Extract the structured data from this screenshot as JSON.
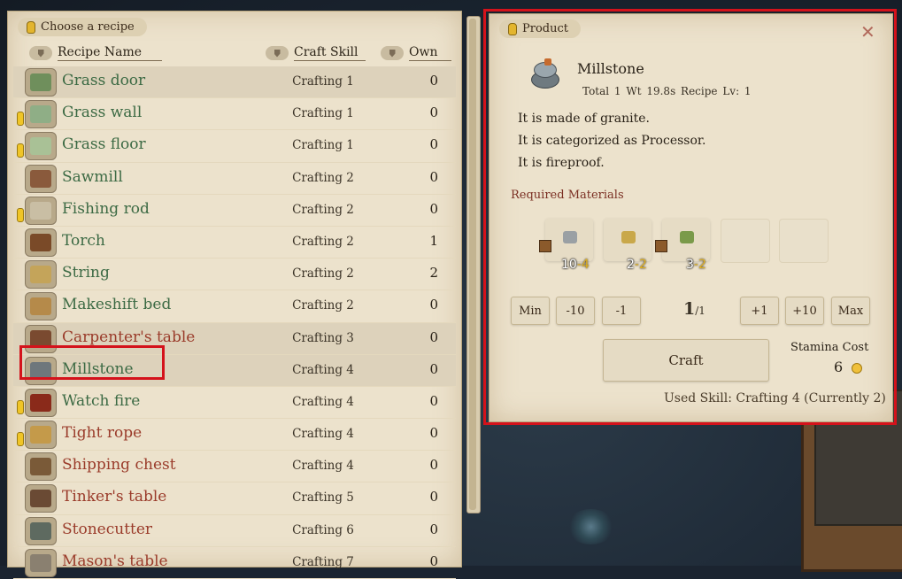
{
  "left": {
    "tab_title": "Choose a recipe",
    "columns": {
      "name": "Recipe Name",
      "skill": "Craft Skill",
      "own": "Own"
    },
    "recipes": [
      {
        "name": "Grass door",
        "skill": "Crafting 1",
        "own": "0",
        "color": "green",
        "warn": false,
        "icon": "grass-door-icon",
        "icon_color": "#6f8f5c"
      },
      {
        "name": "Grass wall",
        "skill": "Crafting 1",
        "own": "0",
        "color": "green",
        "warn": true,
        "icon": "grass-wall-icon",
        "icon_color": "#8fae86"
      },
      {
        "name": "Grass floor",
        "skill": "Crafting 1",
        "own": "0",
        "color": "green",
        "warn": true,
        "icon": "grass-floor-icon",
        "icon_color": "#a9c196"
      },
      {
        "name": "Sawmill",
        "skill": "Crafting 2",
        "own": "0",
        "color": "green",
        "warn": false,
        "icon": "sawmill-icon",
        "icon_color": "#8a5a3c"
      },
      {
        "name": "Fishing rod",
        "skill": "Crafting 2",
        "own": "0",
        "color": "green",
        "warn": true,
        "icon": "fishing-rod-icon",
        "icon_color": "#c9bea4"
      },
      {
        "name": "Torch",
        "skill": "Crafting 2",
        "own": "1",
        "color": "green",
        "warn": false,
        "icon": "torch-icon",
        "icon_color": "#7a4a28"
      },
      {
        "name": "String",
        "skill": "Crafting 2",
        "own": "2",
        "color": "green",
        "warn": false,
        "icon": "string-icon",
        "icon_color": "#c4a45a"
      },
      {
        "name": "Makeshift bed",
        "skill": "Crafting 2",
        "own": "0",
        "color": "green",
        "warn": false,
        "icon": "makeshift-bed-icon",
        "icon_color": "#b58a4a"
      },
      {
        "name": "Carpenter's table",
        "skill": "Crafting 3",
        "own": "0",
        "color": "red",
        "warn": false,
        "icon": "carpenters-table-icon",
        "icon_color": "#7a4a30"
      },
      {
        "name": "Millstone",
        "skill": "Crafting 4",
        "own": "0",
        "color": "green",
        "warn": false,
        "icon": "millstone-icon",
        "icon_color": "#6e777c"
      },
      {
        "name": "Watch fire",
        "skill": "Crafting 4",
        "own": "0",
        "color": "green",
        "warn": true,
        "icon": "watch-fire-icon",
        "icon_color": "#8a2a1a"
      },
      {
        "name": "Tight rope",
        "skill": "Crafting 4",
        "own": "0",
        "color": "red",
        "warn": true,
        "icon": "tight-rope-icon",
        "icon_color": "#c49a4a"
      },
      {
        "name": "Shipping chest",
        "skill": "Crafting 4",
        "own": "0",
        "color": "red",
        "warn": false,
        "icon": "shipping-chest-icon",
        "icon_color": "#7a5a38"
      },
      {
        "name": "Tinker's table",
        "skill": "Crafting 5",
        "own": "0",
        "color": "red",
        "warn": false,
        "icon": "tinkers-table-icon",
        "icon_color": "#6a4a34"
      },
      {
        "name": "Stonecutter",
        "skill": "Crafting 6",
        "own": "0",
        "color": "red",
        "warn": false,
        "icon": "stonecutter-icon",
        "icon_color": "#5e6a60"
      },
      {
        "name": "Mason's table",
        "skill": "Crafting 7",
        "own": "0",
        "color": "red",
        "warn": false,
        "icon": "masons-table-icon",
        "icon_color": "#8a8070"
      }
    ]
  },
  "product": {
    "tab_title": "Product",
    "close_icon": "close-icon",
    "name": "Millstone",
    "meta": "Total 1  Wt 19.8s  Recipe Lv: 1",
    "description": [
      "It is made of granite.",
      "It is categorized as Processor.",
      "It is fireproof."
    ],
    "required_title": "Required Materials",
    "materials": [
      {
        "name": "granite-icon",
        "have": "10",
        "need": "4",
        "color": "#9aa0a4"
      },
      {
        "name": "string-icon",
        "have": "2",
        "need": "2",
        "color": "#c9a84a"
      },
      {
        "name": "twig-icon",
        "have": "3",
        "need": "2",
        "color": "#7a9a4a"
      }
    ],
    "buttons": {
      "min": "Min",
      "m10": "-10",
      "m1": "-1",
      "p1": "+1",
      "p10": "+10",
      "max": "Max"
    },
    "count": "1",
    "count_max": "/1",
    "craft_label": "Craft",
    "stamina_label": "Stamina Cost",
    "stamina_value": "6",
    "used_skill": "Used Skill: Crafting 4 (Currently 2)"
  }
}
